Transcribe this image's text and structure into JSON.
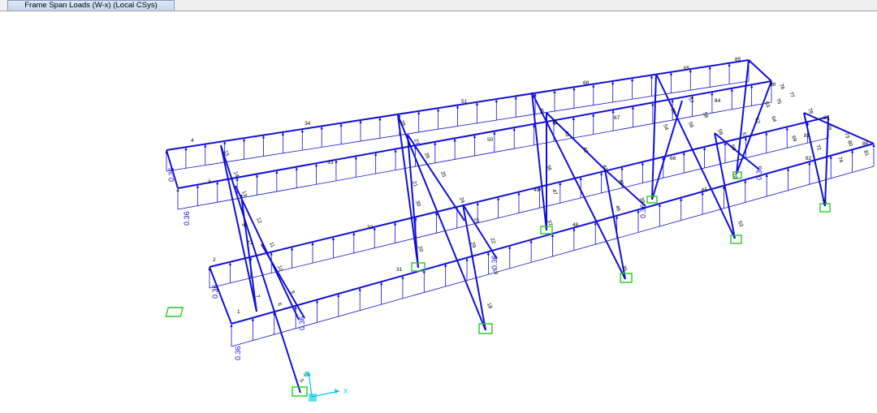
{
  "tab": {
    "title": "Frame Span Loads (W-x) (Local CSys)"
  },
  "load": {
    "value": "0.36"
  },
  "axes": {
    "x": "X",
    "z": "Z"
  },
  "colors": {
    "members": "#1010d8",
    "supports": "#22cc22",
    "axes": "#00c8e8",
    "labels": "#000000"
  },
  "members": {
    "beams": [
      "4",
      "34",
      "51",
      "68",
      "65",
      "3",
      "33",
      "50",
      "67",
      "84",
      "2",
      "32",
      "49",
      "66",
      "83",
      "1",
      "31",
      "48",
      "65",
      "82",
      "85",
      "86",
      "87",
      "88"
    ],
    "bracing": [
      "15",
      "14",
      "13",
      "12",
      "11",
      "10",
      "9",
      "8",
      "17",
      "7",
      "6",
      "5",
      "5",
      "28",
      "27",
      "26",
      "25",
      "24",
      "23",
      "22",
      "21",
      "30",
      "20",
      "19",
      "29",
      "18",
      "36",
      "45",
      "44",
      "43",
      "42",
      "41",
      "40",
      "47",
      "37",
      "46",
      "39",
      "35",
      "53",
      "54",
      "55",
      "56",
      "57",
      "58",
      "59",
      "60",
      "61",
      "62",
      "63",
      "64",
      "69",
      "70",
      "71",
      "72",
      "73",
      "74",
      "75",
      "76",
      "77",
      "78",
      "79",
      "80",
      "81"
    ]
  }
}
